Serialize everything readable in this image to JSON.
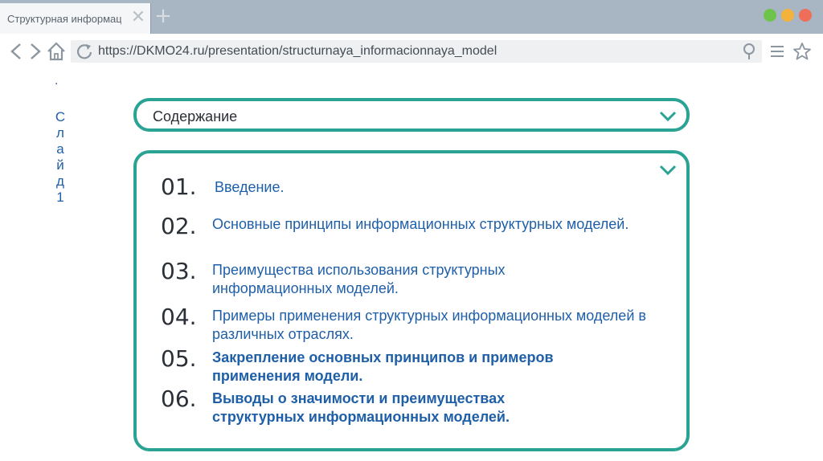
{
  "browser": {
    "tab_title": "Структурная информаци",
    "tab_close": "✕",
    "new_tab": "+",
    "url": "https://DKMO24.ru/presentation/structurnaya_informacionnaya_model",
    "icons": {
      "back": "chevron-left-icon",
      "forward": "chevron-right-icon",
      "home": "home-icon",
      "reload": "reload-icon",
      "location": "location-pin-icon",
      "menu": "menu-icon",
      "bookmark": "star-icon"
    },
    "window_controls": [
      "#6ec44b",
      "#f3b23b",
      "#ef6e5a"
    ]
  },
  "sidebar": {
    "dot": ".",
    "vertical_label": "Слайд1"
  },
  "contents": {
    "title": "Содержание",
    "items": [
      {
        "num": "01.",
        "text": "Введение."
      },
      {
        "num": "02.",
        "text": "Основные принципы информационных структурных моделей."
      },
      {
        "num": "03.",
        "text": "Преимущества использования структурных информационных моделей."
      },
      {
        "num": "04.",
        "text": "Примеры применения структурных информационных моделей в различных отраслях."
      },
      {
        "num": "05.",
        "text": "Закрепление основных принципов и примеров применения модели."
      },
      {
        "num": "06.",
        "text": "Выводы о значимости и преимуществах структурных информационных моделей."
      }
    ]
  },
  "colors": {
    "accent": "#2aa394",
    "link": "#1f5fa8"
  }
}
